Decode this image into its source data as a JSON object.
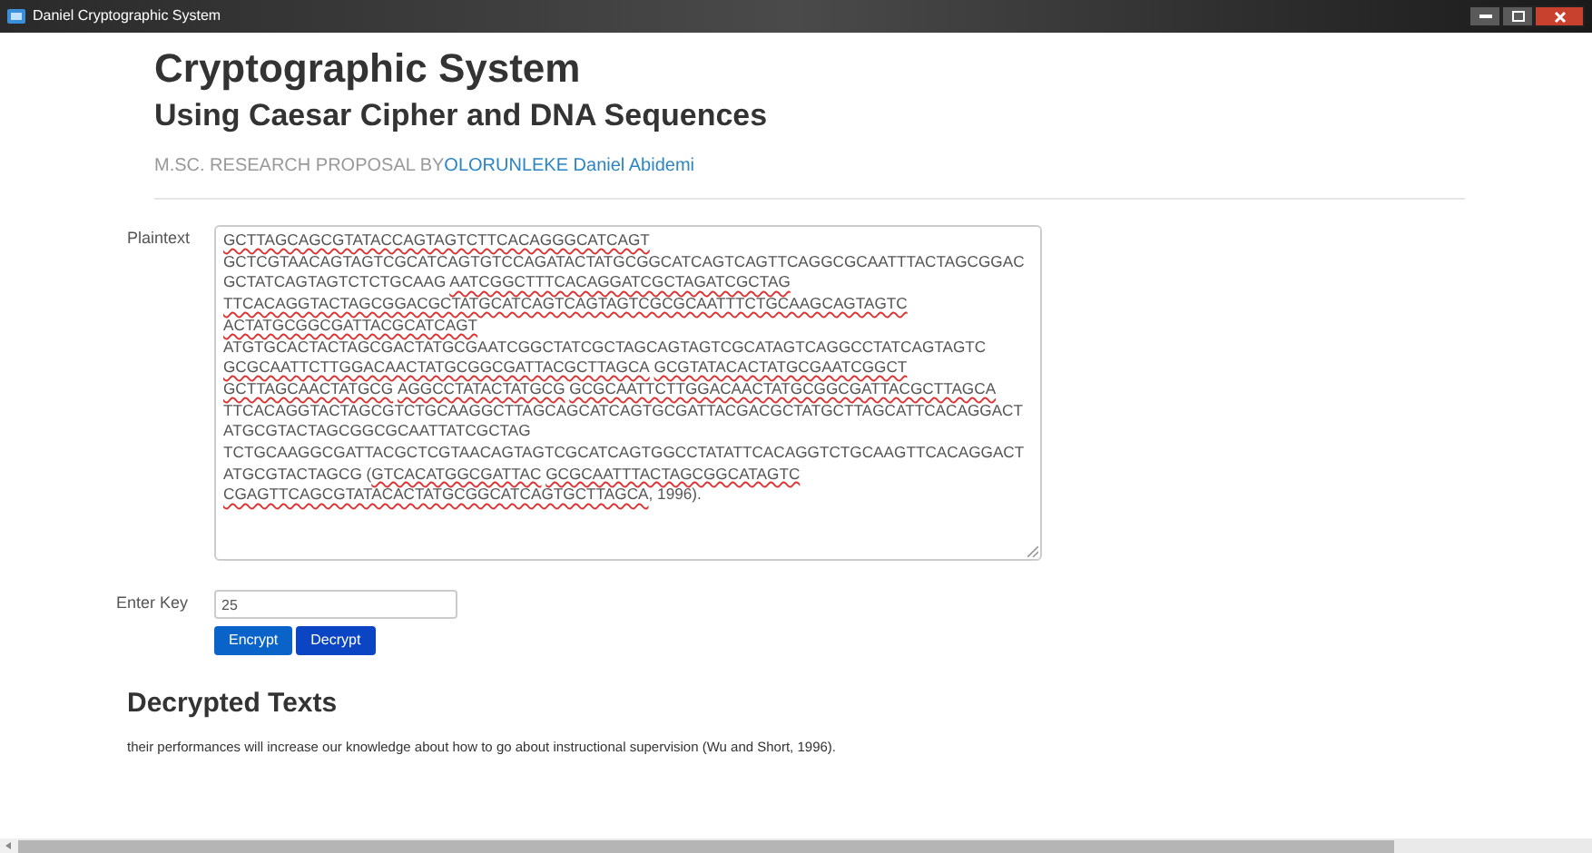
{
  "window": {
    "title": "Daniel Cryptographic System"
  },
  "header": {
    "title": "Cryptographic System",
    "subtitle": "Using Caesar Cipher and DNA Sequences",
    "byline": "M.SC. RESEARCH PROPOSAL BY",
    "author": "OLORUNLEKE Daniel Abidemi"
  },
  "plaintext": {
    "label": "Plaintext",
    "lines": [
      [
        {
          "text": "GCTTAGCAGCGTATACCAGTAGTCTTCACAGGGCATCAGT",
          "misspelled": true
        }
      ],
      [
        {
          "text": "GCTCGTAACAGTAGTCGCATCAGTGTCCAGATACTATGCGGCATCAGTCAGTTCAGGCGCAATTTACTAGCGGAC",
          "misspelled": false
        }
      ],
      [
        {
          "text": "GCTATCAGTAGTCTCTGCAAG ",
          "misspelled": false
        },
        {
          "text": "AATCGGCTTTCACAGGATCGCTAGATCGCTAG",
          "misspelled": true
        }
      ],
      [
        {
          "text": "TTCACAGGTACTAGCGGACGCTATGCATCAGTCAGTAGTCGCGCAATTTCTGCAAGCAGTAGTC",
          "misspelled": true
        }
      ],
      [
        {
          "text": "ACTATGCGGCGATTACGCATCAGT",
          "misspelled": true
        }
      ],
      [
        {
          "text": "ATGTGCACTACTAGCGACTATGCGAATCGGCTATCGCTAGCAGTAGTCGCATAGTCAGGCCTATCAGTAGTC",
          "misspelled": false
        }
      ],
      [
        {
          "text": "GCGCAATTCTTGGACAACTATGCGGCGATTACGCTTAGCA",
          "misspelled": true,
          "space_after": true
        },
        {
          "text": "GCGTATACACTATGCGAATCGGCT",
          "misspelled": true
        }
      ],
      [
        {
          "text": "GCTTAGCAACTATGCG",
          "misspelled": true,
          "space_after": true
        },
        {
          "text": "AGGCCTATACTATGCG",
          "misspelled": true,
          "space_after": true
        },
        {
          "text": "GCGCAATTCTTGGACAACTATGCGGCGATTACGCTTAGCA",
          "misspelled": true
        }
      ],
      [
        {
          "text": "TTCACAGGTACTAGCGTCTGCAAGGCTTAGCAGCATCAGTGCGATTACGACGCTATGCTTAGCATTCACAGGACT",
          "misspelled": false
        }
      ],
      [
        {
          "text": "ATGCGTACTAGCGGCGCAATTATCGCTAG",
          "misspelled": false
        }
      ],
      [
        {
          "text": "TCTGCAAGGCGATTACGCTCGTAACAGTAGTCGCATCAGTGGCCTATATTCACAGGTCTGCAAGTTCACAGGACT",
          "misspelled": false
        }
      ],
      [
        {
          "text": "ATGCGTACTAGCG (",
          "misspelled": false
        },
        {
          "text": "GTCACATGGCGATTAC",
          "misspelled": true,
          "space_after": true
        },
        {
          "text": "GCGCAATTTACTAGCGGCATAGTC",
          "misspelled": true
        }
      ],
      [
        {
          "text": "CGAGTTCAGCGTATACACTATGCGGCATCAGTGCTTAGCA",
          "misspelled": true
        },
        {
          "text": ", 1996).",
          "misspelled": false
        }
      ]
    ]
  },
  "key": {
    "label": "Enter Key",
    "value": "25"
  },
  "buttons": [
    "Encrypt",
    "Decrypt"
  ],
  "result": {
    "heading": "Decrypted Texts",
    "text": "their performances will increase our knowledge about how to go about instructional supervision (Wu and Short, 1996)."
  }
}
